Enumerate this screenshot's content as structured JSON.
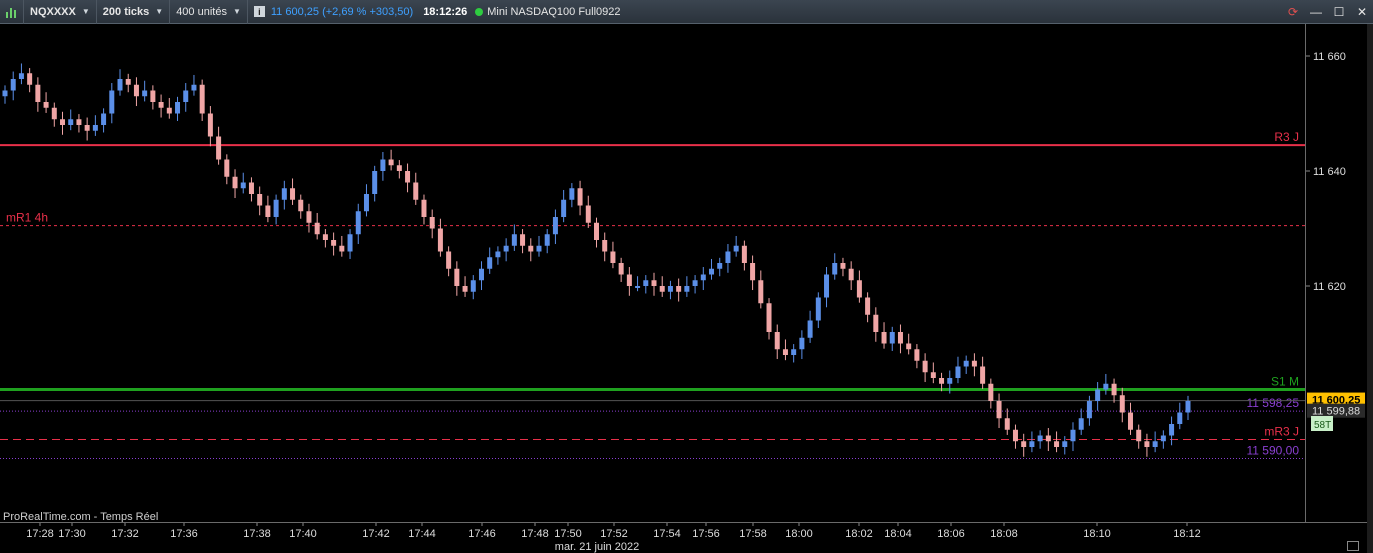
{
  "toolbar": {
    "symbol": "NQXXXX",
    "interval": "200 ticks",
    "units": "400 unités",
    "info_icon": "i",
    "last_price": "11 600,25",
    "change": "(+2,69 % +303,50)",
    "time": "18:12:26",
    "instrument": "Mini NASDAQ100 Full0922",
    "chart_icon": "bar-chart-icon",
    "window_buttons": [
      "refresh-icon",
      "minimize-icon",
      "maximize-icon",
      "close-icon"
    ]
  },
  "source_label": "ProRealTime.com - Temps Réel",
  "colors": {
    "up": "#5b8fe8",
    "down": "#f0a6a6",
    "resistance": "#e8304a",
    "support": "#1fa01f",
    "purple": "#8a3fd1",
    "current": "#ffc000"
  },
  "chart_data": {
    "type": "candlestick",
    "ylim": [
      11588,
      11700
    ],
    "y_ticks": [
      "11 660",
      "11 640",
      "11 620"
    ],
    "y_tick_values": [
      11660,
      11640,
      11620
    ],
    "x_ticks": [
      "17:28",
      "17:30",
      "17:32",
      "17:36",
      "17:38",
      "17:40",
      "17:42",
      "17:44",
      "17:46",
      "17:48",
      "17:50",
      "17:52",
      "17:54",
      "17:56",
      "17:58",
      "18:00",
      "18:02",
      "18:04",
      "18:06",
      "18:08",
      "18:10",
      "18:12"
    ],
    "date_label": "mar. 21 juin 2022",
    "levels": [
      {
        "label": "R3 J",
        "value": 11644.5,
        "style": "solid",
        "color": "#e8304a"
      },
      {
        "label": "mR1 4h",
        "value": 11630.5,
        "style": "dashed",
        "color": "#e8304a"
      },
      {
        "label": "S1 M",
        "value": 11602.0,
        "style": "solid",
        "color": "#1fa01f"
      },
      {
        "label": "11 598,25",
        "value": 11598.25,
        "style": "dotted",
        "color": "#8a3fd1"
      },
      {
        "label": "mR3 J",
        "value": 11593.3,
        "style": "dashed",
        "color": "#e8304a"
      },
      {
        "label": "11 590,00",
        "value": 11590.0,
        "style": "dotted",
        "color": "#8a3fd1"
      }
    ],
    "current_price": {
      "label": "11 600,25",
      "value": 11600.25
    },
    "other_price": {
      "label": "11 599,88",
      "value": 11599.88
    },
    "tick_badge": "58T",
    "closes": [
      11654,
      11656,
      11657,
      11655,
      11652,
      11651,
      11649,
      11648,
      11649,
      11648,
      11647,
      11648,
      11650,
      11654,
      11656,
      11655,
      11653,
      11654,
      11652,
      11651,
      11650,
      11652,
      11654,
      11655,
      11650,
      11646,
      11642,
      11639,
      11637,
      11638,
      11636,
      11634,
      11632,
      11635,
      11637,
      11635,
      11633,
      11631,
      11629,
      11628,
      11627,
      11626,
      11629,
      11633,
      11636,
      11640,
      11642,
      11641,
      11640,
      11638,
      11635,
      11632,
      11630,
      11626,
      11623,
      11620,
      11619,
      11621,
      11623,
      11625,
      11626,
      11627,
      11629,
      11627,
      11626,
      11627,
      11629,
      11632,
      11635,
      11637,
      11634,
      11631,
      11628,
      11626,
      11624,
      11622,
      11620,
      11620,
      11621,
      11620,
      11619,
      11620,
      11619,
      11620,
      11621,
      11622,
      11623,
      11624,
      11626,
      11627,
      11624,
      11621,
      11617,
      11612,
      11609,
      11608,
      11609,
      11611,
      11614,
      11618,
      11622,
      11624,
      11623,
      11621,
      11618,
      11615,
      11612,
      11610,
      11612,
      11610,
      11609,
      11607,
      11605,
      11604,
      11603,
      11604,
      11606,
      11607,
      11606,
      11603,
      11600,
      11597,
      11595,
      11593,
      11592,
      11593,
      11594,
      11593,
      11592,
      11593,
      11595,
      11597,
      11600,
      11602,
      11603,
      11601,
      11598,
      11595,
      11593,
      11592,
      11593,
      11594,
      11596,
      11598,
      11600
    ],
    "series": [
      {
        "name": "NQXXXX",
        "kind": "candles"
      }
    ]
  }
}
